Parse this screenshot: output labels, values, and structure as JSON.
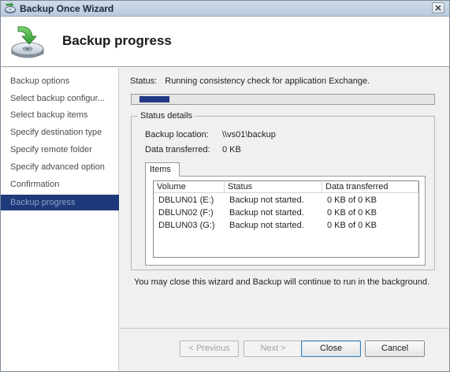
{
  "window": {
    "title": "Backup Once Wizard"
  },
  "header": {
    "title": "Backup progress"
  },
  "sidebar": {
    "items": [
      {
        "label": "Backup options"
      },
      {
        "label": "Select backup configur..."
      },
      {
        "label": "Select backup items"
      },
      {
        "label": "Specify destination type"
      },
      {
        "label": "Specify remote folder"
      },
      {
        "label": "Specify advanced option"
      },
      {
        "label": "Confirmation"
      },
      {
        "label": "Backup progress",
        "active": true
      }
    ]
  },
  "status": {
    "label": "Status:",
    "text": "Running consistency check for application Exchange.",
    "progress_percent": 10
  },
  "details": {
    "legend": "Status details",
    "backup_location_label": "Backup location:",
    "backup_location_value": "\\\\vs01\\backup",
    "data_transferred_label": "Data transferred:",
    "data_transferred_value": "0 KB"
  },
  "items_tab": {
    "label": "Items",
    "columns": [
      "Volume",
      "Status",
      "Data transferred"
    ],
    "rows": [
      {
        "volume": "DBLUN01 (E:)",
        "status": "Backup not started.",
        "data": "0 KB of 0 KB"
      },
      {
        "volume": "DBLUN02 (F:)",
        "status": "Backup not started.",
        "data": "0 KB of 0 KB"
      },
      {
        "volume": "DBLUN03 (G:)",
        "status": "Backup not started.",
        "data": "0 KB of 0 KB"
      }
    ]
  },
  "note": "You may close this wizard and Backup will continue to run in the background.",
  "buttons": {
    "previous": "< Previous",
    "next": "Next >",
    "close": "Close",
    "cancel": "Cancel"
  },
  "colors": {
    "accent": "#243a84",
    "sidebar_active_bg": "#1f3a7a",
    "sidebar_active_text": "#8fa1c9"
  },
  "icons": {
    "title": "backup-disk-icon",
    "header": "backup-disk-arrow-icon",
    "close": "close-icon"
  }
}
